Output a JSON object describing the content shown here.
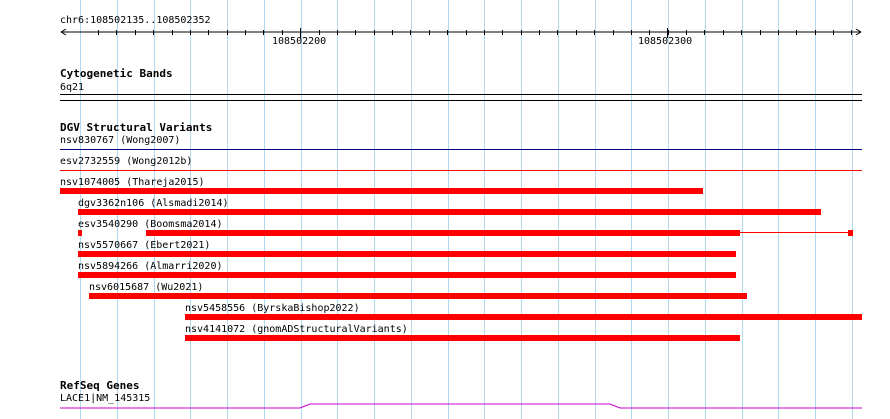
{
  "ruler": {
    "region": "chr6:108502135..108502352",
    "ticks": [
      {
        "label": "108502200"
      },
      {
        "label": "108502300"
      }
    ]
  },
  "cytoband": {
    "title": "Cytogenetic Bands",
    "band": "6q21"
  },
  "dgv": {
    "title": "DGV Structural Variants",
    "variants": [
      {
        "label": "nsv830767 (Wong2007)",
        "color": "#000080"
      },
      {
        "label": "esv2732559 (Wong2012b)",
        "color": "#ff0000"
      },
      {
        "label": "nsv1074005 (Thareja2015)",
        "color": "#ff0000"
      },
      {
        "label": "dgv3362n106 (Alsmadi2014)",
        "color": "#ff0000"
      },
      {
        "label": "esv3540290 (Boomsma2014)",
        "color": "#ff0000"
      },
      {
        "label": "nsv5570667 (Ebert2021)",
        "color": "#ff0000"
      },
      {
        "label": "nsv5894266 (Almarri2020)",
        "color": "#ff0000"
      },
      {
        "label": "nsv6015687 (Wu2021)",
        "color": "#ff0000"
      },
      {
        "label": "nsv5458556 (ByrskaBishop2022)",
        "color": "#ff0000"
      },
      {
        "label": "nsv4141072 (gnomADStructuralVariants)",
        "color": "#ff0000"
      }
    ]
  },
  "refseq": {
    "title": "RefSeq Genes",
    "gene": "LACE1|NM_145315",
    "color": "#cc00cc"
  },
  "colors": {
    "gridline": "#b0d8f0",
    "variant": "#ff0000",
    "wong2007": "#000080"
  }
}
